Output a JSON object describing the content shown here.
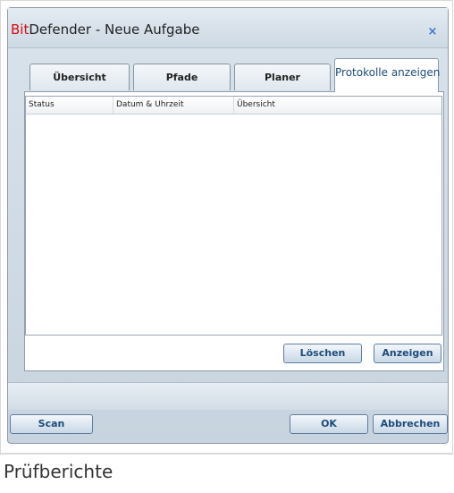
{
  "window": {
    "title_brand": "Bit",
    "title_rest": "Defender - Neue Aufgabe",
    "close_glyph": "×"
  },
  "tabs": [
    {
      "label": "Übersicht",
      "active": false
    },
    {
      "label": "Pfade",
      "active": false
    },
    {
      "label": "Planer",
      "active": false
    },
    {
      "label": "Protokolle anzeigen",
      "active": true
    }
  ],
  "list": {
    "columns": [
      "Status",
      "Datum & Uhrzeit",
      "Übersicht"
    ],
    "rows": []
  },
  "panel_buttons": {
    "delete_label": "Löschen",
    "view_label": "Anzeigen"
  },
  "footer_buttons": {
    "scan_label": "Scan",
    "ok_label": "OK",
    "cancel_label": "Abbrechen"
  },
  "caption": "Prüfberichte",
  "colors": {
    "brand_red": "#d40d12",
    "button_text": "#1d4b7a",
    "close_blue": "#3a79c9"
  }
}
